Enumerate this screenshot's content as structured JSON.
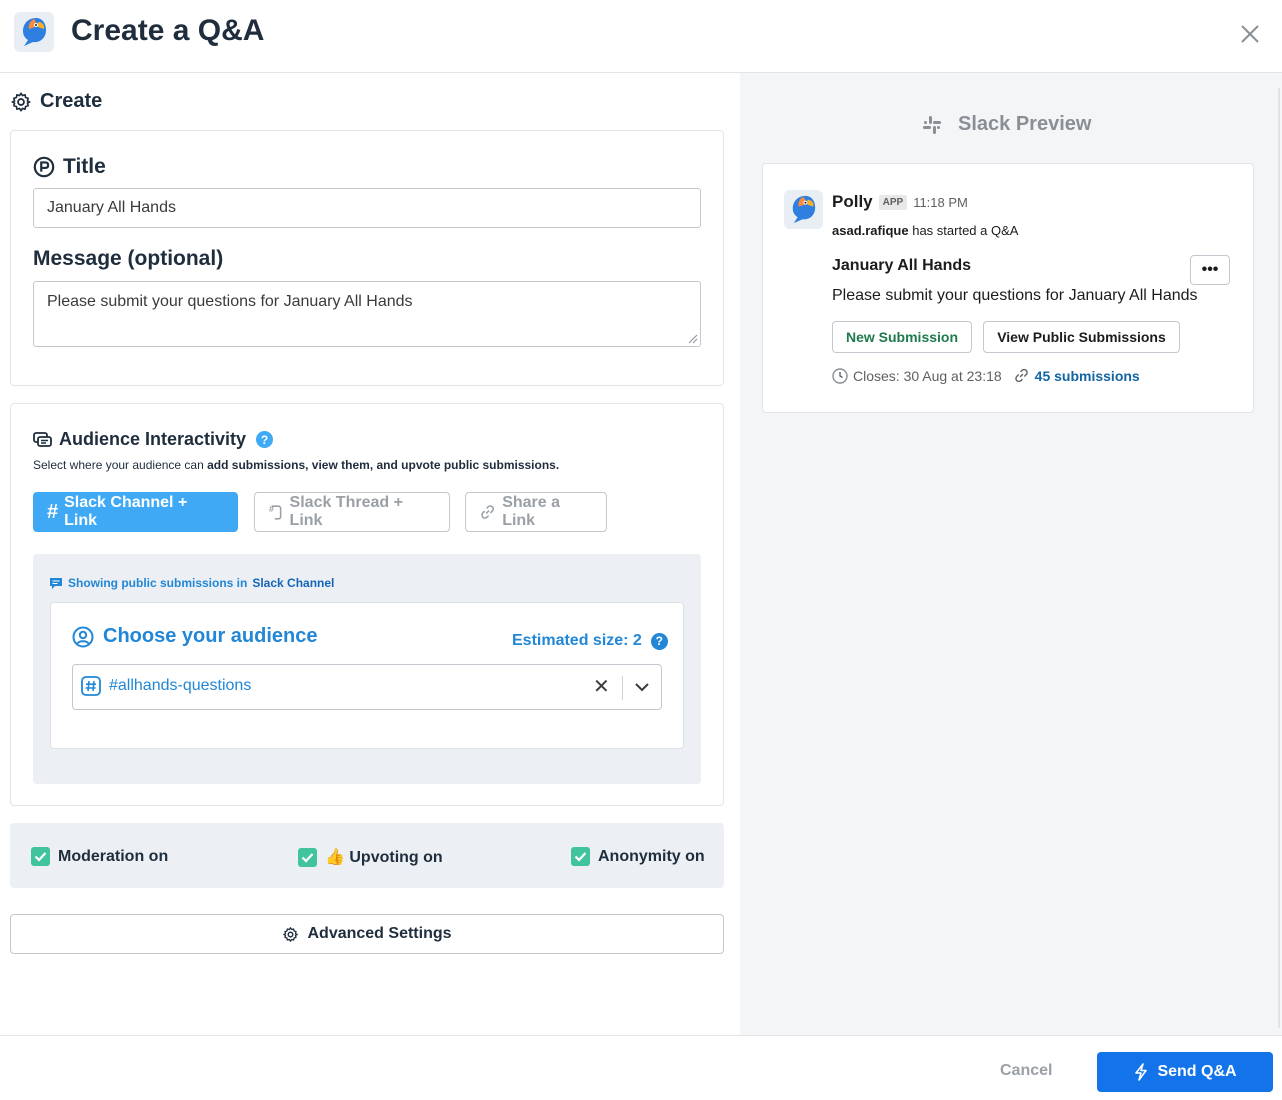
{
  "header": {
    "title": "Create a Q&A"
  },
  "create": {
    "heading": "Create",
    "title_label": "Title",
    "title_value": "January All Hands",
    "message_label": "Message (optional)",
    "message_value": "Please submit your questions for January All Hands"
  },
  "audience": {
    "heading": "Audience Interactivity",
    "help": "?",
    "desc_prefix": "Select where your audience can ",
    "desc_bold": "add submissions, view them, and upvote public submissions.",
    "modes": [
      {
        "label": "Slack Channel + Link",
        "active": true
      },
      {
        "label": "Slack Thread + Link",
        "active": false
      },
      {
        "label": "Share a Link",
        "active": false
      }
    ],
    "showing_prefix": "Showing public submissions in",
    "showing_target": "Slack Channel",
    "choose_title": "Choose your audience",
    "estimated_size": "Estimated size: 2",
    "selected_channel": "#allhands-questions"
  },
  "toggles": [
    {
      "label": "Moderation on",
      "checked": true
    },
    {
      "label": "👍 Upvoting on",
      "checked": true
    },
    {
      "label": "Anonymity on",
      "checked": true
    }
  ],
  "advanced_settings": "Advanced Settings",
  "preview": {
    "title": "Slack Preview",
    "bot_name": "Polly",
    "app_badge": "APP",
    "time": "11:18 PM",
    "user": "asad.rafique",
    "started_text": "has started a Q&A",
    "msg_title": "January All Hands",
    "msg_body": "Please submit your questions for January All Hands",
    "more": "•••",
    "btn_new": "New Submission",
    "btn_view": "View Public Submissions",
    "closes": "Closes: 30 Aug at 23:18",
    "submissions": "45 submissions"
  },
  "footer": {
    "cancel": "Cancel",
    "send": "Send Q&A"
  },
  "colors": {
    "accent": "#3fa9f5",
    "link_blue": "#2187d6",
    "primary": "#1273eb",
    "check_green": "#41c39d"
  }
}
